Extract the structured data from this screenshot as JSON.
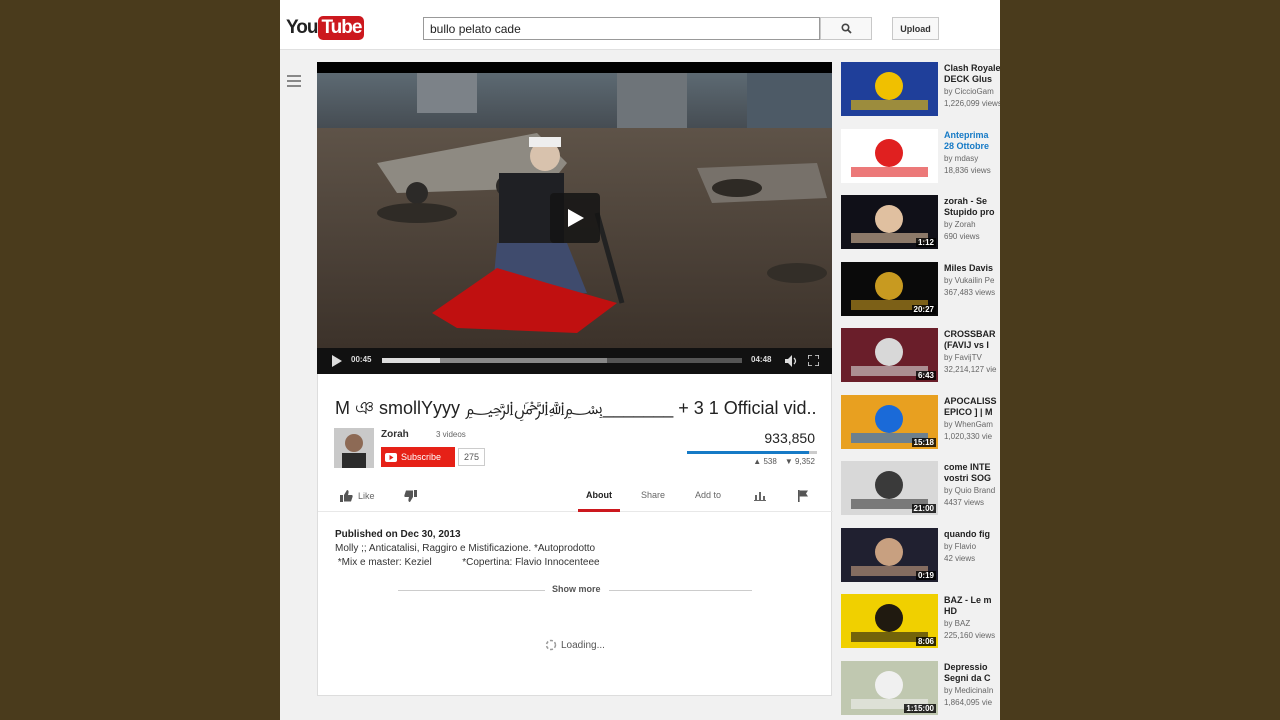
{
  "header": {
    "logo_you": "You",
    "logo_tube": "Tube",
    "search_value": "bullo pelato cade",
    "upload_label": "Upload"
  },
  "player": {
    "current_time": "00:45",
    "duration": "04:48",
    "progress": 0.16
  },
  "video": {
    "title": "M  ঞ  smollYyyy  ﷽_______ +  3  1  Official vid...",
    "channel_name": "Zorah",
    "videos_count": "3 videos",
    "subscribe_label": "Subscribe",
    "subscriber_count": "275",
    "views": "933,850",
    "likes": "538",
    "dislikes": "9,352",
    "like_label": "Like"
  },
  "tabs": {
    "about": "About",
    "share": "Share",
    "add_to": "Add to"
  },
  "description": {
    "published": "Published on Dec 30, 2013",
    "line1": "Molly ;; Anticatalisi, Raggiro e Mistificazione.   *Autoprodotto",
    "line2": " *Mix e master: Keziel           *Copertina: Flavio Innocenteee",
    "show_more": "Show more",
    "loading": "Loading..."
  },
  "sidebar": {
    "items": [
      {
        "title": "Clash Royale DECK Glush",
        "title2": "DECK Glus",
        "channel": "by CiccioGam",
        "views": "1,226,099 views",
        "duration": "",
        "blue": false
      },
      {
        "title": "Anteprima",
        "title2": "28 Ottobre",
        "channel": "by mdasy",
        "views": "18,836 views",
        "duration": "",
        "blue": true
      },
      {
        "title": "zorah - Se",
        "title2": "Stupido pro",
        "channel": "by Zorah",
        "views": "690 views",
        "duration": "1:12",
        "blue": false
      },
      {
        "title": "Miles Davis",
        "title2": "",
        "channel": "by Vukailin Pe",
        "views": "367,483 views",
        "duration": "20:27",
        "blue": false
      },
      {
        "title": "CROSSBAR",
        "title2": "(FAVIJ vs I",
        "channel": "by FavijTV",
        "views": "32,214,127 vie",
        "duration": "6:43",
        "blue": false
      },
      {
        "title": "APOCALISS",
        "title2": "EPICO ] | M",
        "channel": "by WhenGam",
        "views": "1,020,330 vie",
        "duration": "15:18",
        "blue": false
      },
      {
        "title": "come INTE",
        "title2": "vostri SOG",
        "channel": "by Quio Brand",
        "views": "4437 views",
        "duration": "21:00",
        "blue": false
      },
      {
        "title": " quando fig",
        "title2": "",
        "channel": "by Flavio",
        "views": "42 views",
        "duration": "0:19",
        "blue": false
      },
      {
        "title": "BAZ - Le m",
        "title2": "HD",
        "channel": "by BAZ",
        "views": "225,160 views",
        "duration": "8:06",
        "blue": false
      },
      {
        "title": "Depressio",
        "title2": "Segni da C",
        "channel": "by MedicinaIn",
        "views": "1,864,095 vie",
        "duration": "1:15:00",
        "blue": false
      }
    ]
  },
  "colors": {
    "accent_red": "#cc181e",
    "subscribe_red": "#e62117",
    "link_blue": "#167ac6",
    "outer_background": "#4a3b1c"
  }
}
